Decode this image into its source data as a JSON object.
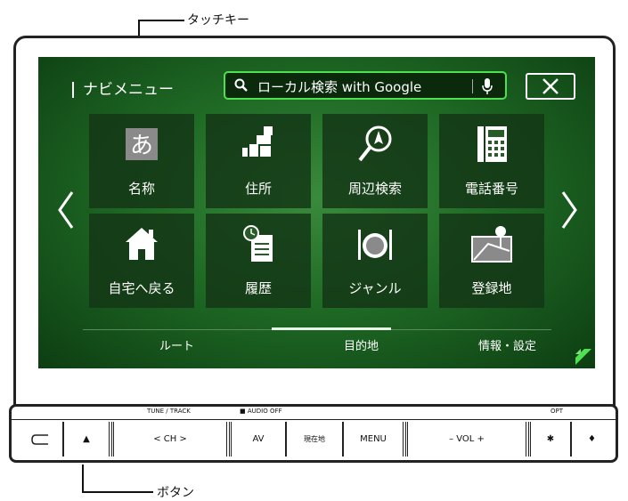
{
  "callouts": {
    "touch_key": "タッチキー",
    "buttons": "ボタン"
  },
  "screen": {
    "menu_title": "ナビメニュー",
    "search": {
      "label": "ローカル検索 with Google"
    },
    "tiles": [
      {
        "label": "名称",
        "icon": "a-hiragana-icon"
      },
      {
        "label": "住所",
        "icon": "map-blocks-icon"
      },
      {
        "label": "周辺検索",
        "icon": "compass-search-icon"
      },
      {
        "label": "電話番号",
        "icon": "phone-icon"
      },
      {
        "label": "自宅へ戻る",
        "icon": "home-icon"
      },
      {
        "label": "履歴",
        "icon": "history-icon"
      },
      {
        "label": "ジャンル",
        "icon": "restaurant-icon"
      },
      {
        "label": "登録地",
        "icon": "map-pin-icon"
      }
    ],
    "tabs": [
      "ルート",
      "目的地",
      "情報・設定"
    ]
  },
  "button_strip": {
    "labels": {
      "tune_track": "TUNE / TRACK",
      "audio_off": "■ AUDIO OFF",
      "opt": "OPT"
    },
    "keys": {
      "eject": "▲",
      "ch": "<  CH  >",
      "av": "AV",
      "current_location": "現在地",
      "menu": "MENU",
      "vol": "–  VOL  +",
      "star": "✱",
      "mic": "♦"
    }
  },
  "colors": {
    "accent": "#4fe04f",
    "screen_green": "#1f6a25"
  }
}
